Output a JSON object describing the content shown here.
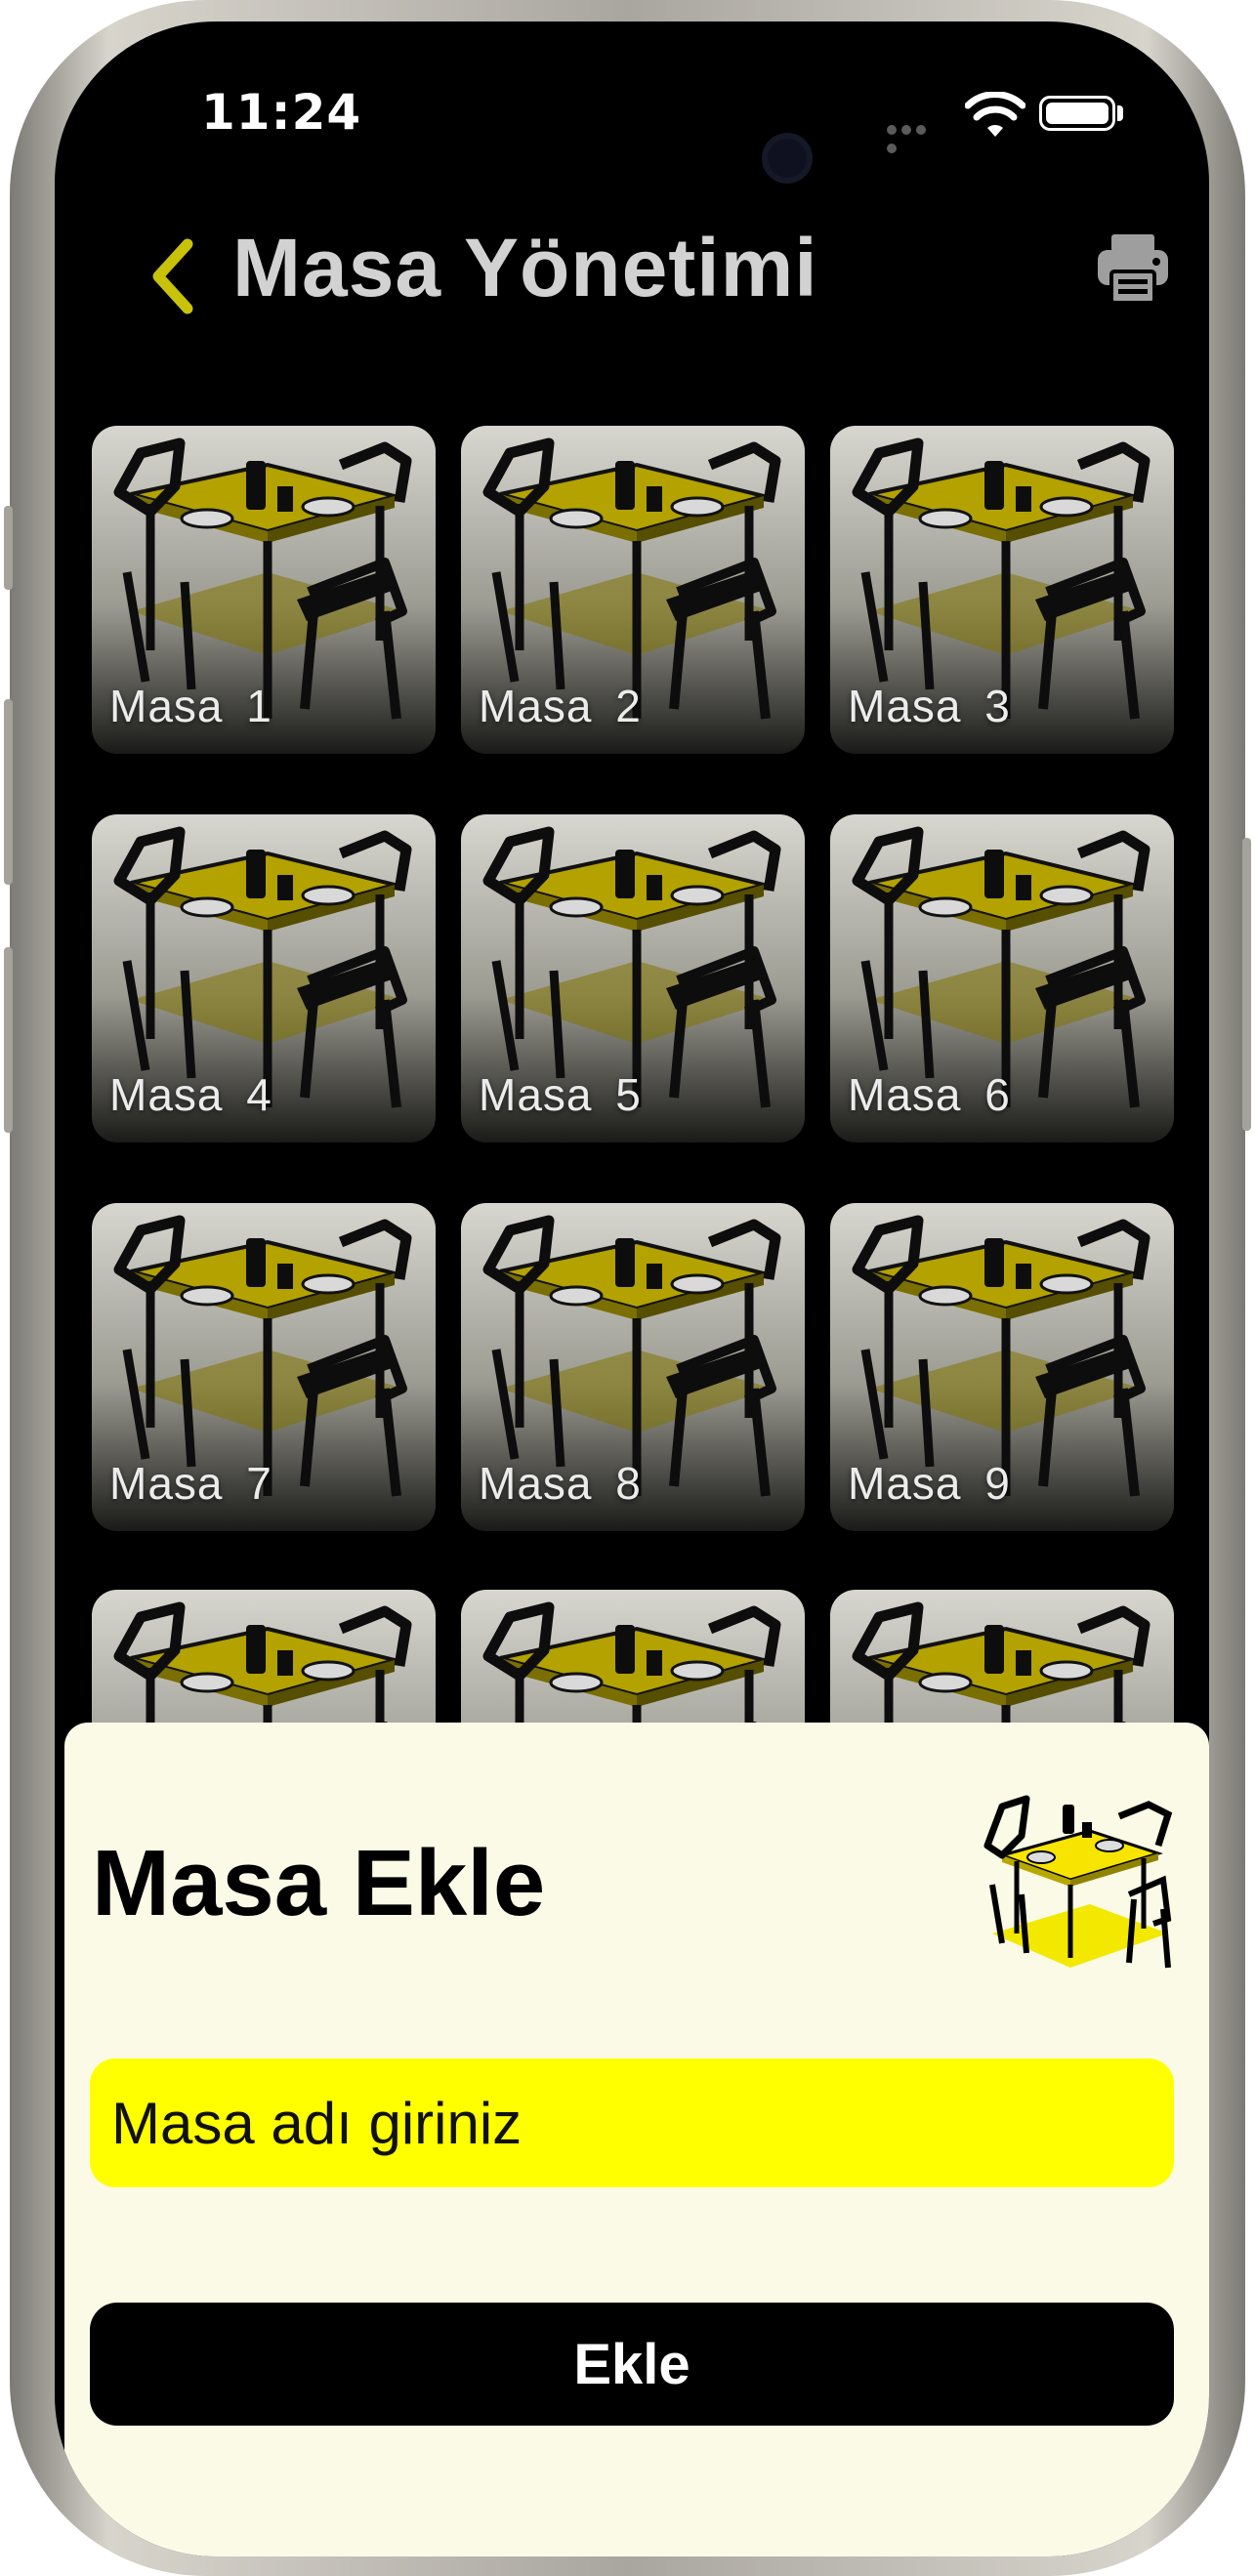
{
  "status_bar": {
    "time": "11:24"
  },
  "header": {
    "title": "Masa Yönetimi"
  },
  "tables": [
    "Masa  1",
    "Masa  2",
    "Masa  3",
    "Masa  4",
    "Masa  5",
    "Masa  6",
    "Masa  7",
    "Masa  8",
    "Masa  9",
    "",
    "",
    ""
  ],
  "add_sheet": {
    "title": "Masa Ekle",
    "input_placeholder": "Masa adı giriniz",
    "input_value": "",
    "button_label": "Ekle"
  },
  "colors": {
    "accent": "#c8c20a",
    "input_bg": "#ffff00",
    "sheet_bg": "#fbfae6",
    "screen_bg": "#000000"
  },
  "icons": {
    "back": "chevron-left-icon",
    "print": "printer-icon",
    "tile": "dining-table-icon"
  }
}
